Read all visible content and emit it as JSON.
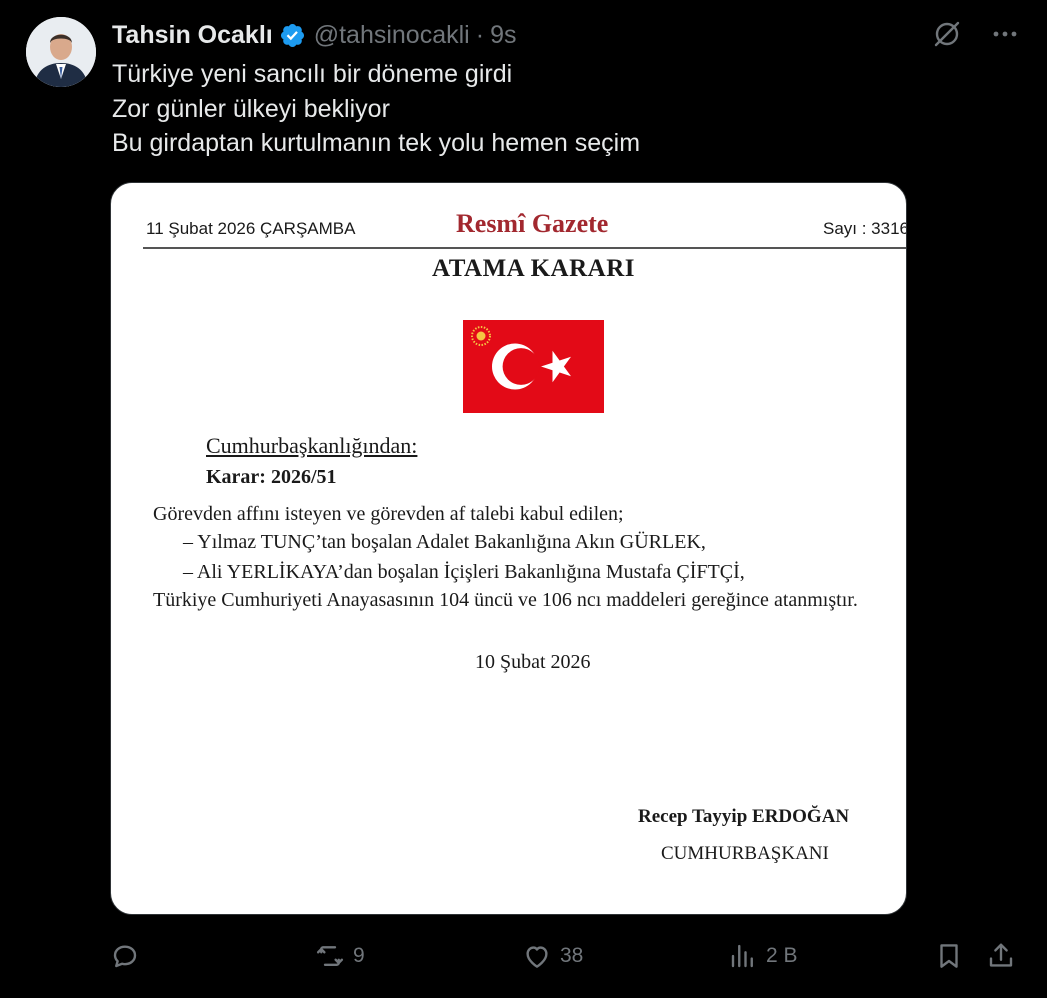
{
  "tweet": {
    "author_name": "Tahsin Ocaklı",
    "handle": "@tahsinocakli",
    "separator": "·",
    "time": "9s",
    "text_lines": [
      "Türkiye yeni sancılı bir döneme girdi",
      "Zor günler ülkeyi bekliyor",
      "Bu girdaptan kurtulmanın tek yolu hemen seçim"
    ]
  },
  "document": {
    "date": "11 Şubat 2026 ÇARŞAMBA",
    "gazette_title": "Resmî Gazete",
    "issue": "Sayı : 3316",
    "heading": "ATAMA KARARI",
    "office": "Cumhurbaşkanlığından:",
    "decision": "Karar: 2026/51",
    "intro": "Görevden affını isteyen ve görevden af talebi kabul edilen;",
    "items": [
      "–    Yılmaz TUNÇ’tan boşalan Adalet Bakanlığına Akın GÜRLEK,",
      "–    Ali YERLİKAYA’dan boşalan İçişleri Bakanlığına Mustafa ÇİFTÇİ,"
    ],
    "closing": "Türkiye Cumhuriyeti Anayasasının 104 üncü ve 106 ncı maddeleri gereğince atanmıştır.",
    "sign_date": "10 Şubat 2026",
    "signatory": "Recep Tayyip ERDOĞAN",
    "signatory_title": "CUMHURBAŞKANI"
  },
  "actions": {
    "replies": "",
    "retweets": "9",
    "likes": "38",
    "views": "2 B"
  },
  "colors": {
    "background": "#000000",
    "text": "#e7e9ea",
    "muted": "#71767b",
    "verified": "#1d9bf0",
    "gazette_red": "#a2282f",
    "flag_red": "#e30a17"
  },
  "icons": [
    "verified-badge-icon",
    "grok-icon",
    "more-icon",
    "reply-icon",
    "retweet-icon",
    "like-icon",
    "views-icon",
    "bookmark-icon",
    "share-icon"
  ]
}
